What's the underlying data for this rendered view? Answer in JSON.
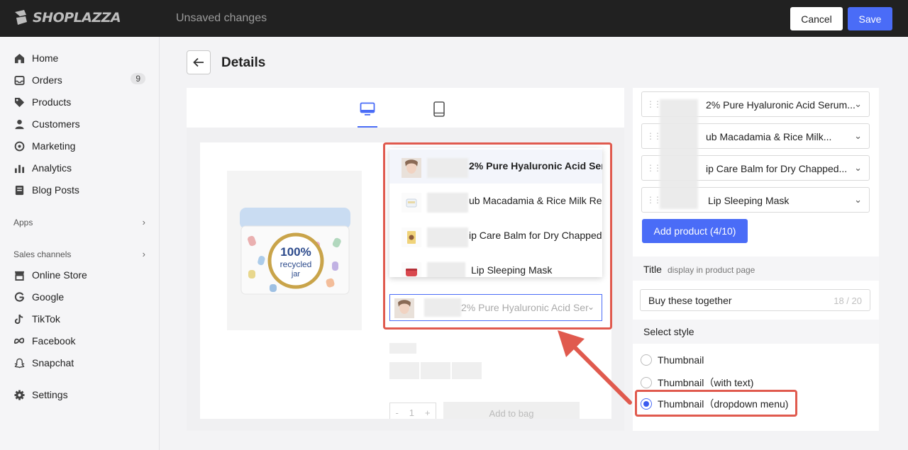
{
  "topbar": {
    "brand": "SHOPLAZZA",
    "status": "Unsaved changes",
    "cancel_label": "Cancel",
    "save_label": "Save"
  },
  "sidebar": {
    "items": [
      {
        "label": "Home",
        "icon": "home-icon"
      },
      {
        "label": "Orders",
        "icon": "inbox-icon",
        "badge": "9"
      },
      {
        "label": "Products",
        "icon": "tag-icon"
      },
      {
        "label": "Customers",
        "icon": "person-icon"
      },
      {
        "label": "Marketing",
        "icon": "target-icon"
      },
      {
        "label": "Analytics",
        "icon": "bar-chart-icon"
      },
      {
        "label": "Blog Posts",
        "icon": "document-icon"
      }
    ],
    "apps_label": "Apps",
    "channels_label": "Sales channels",
    "channels": [
      {
        "label": "Online Store",
        "icon": "store-icon"
      },
      {
        "label": "Google",
        "icon": "google-icon"
      },
      {
        "label": "TikTok",
        "icon": "tiktok-icon"
      },
      {
        "label": "Facebook",
        "icon": "meta-icon"
      },
      {
        "label": "Snapchat",
        "icon": "ghost-icon"
      }
    ],
    "settings_label": "Settings"
  },
  "header": {
    "title": "Details"
  },
  "preview": {
    "product_image_text": [
      "100%",
      "recycled",
      "jar"
    ],
    "dropdown": [
      {
        "text": "2% Pure Hyaluronic Acid Ser",
        "selected": true
      },
      {
        "text": "ub Macadamia & Rice Milk Re",
        "selected": false
      },
      {
        "text": "ip Care Balm for Dry Chapped",
        "selected": false
      },
      {
        "text": "Lip Sleeping Mask",
        "selected": false
      }
    ],
    "select_value": "2% Pure Hyaluronic Acid Ser",
    "quantity": "1",
    "qty_minus": "-",
    "qty_plus": "+",
    "add_to_bag": "Add to bag"
  },
  "panel": {
    "products": [
      {
        "text": "2% Pure Hyaluronic Acid Serum..."
      },
      {
        "text": "ub Macadamia & Rice Milk..."
      },
      {
        "text": "ip Care Balm for Dry Chapped..."
      },
      {
        "text": "Lip Sleeping Mask"
      }
    ],
    "add_product_label": "Add product (4/10)",
    "title_label": "Title",
    "title_hint": "display in product page",
    "title_value": "Buy these together",
    "title_count": "18 / 20",
    "style_label": "Select style",
    "styles": [
      {
        "label": "Thumbnail",
        "checked": false
      },
      {
        "label": "Thumbnail（with text)",
        "checked": false
      },
      {
        "label": "Thumbnail（dropdown menu)",
        "checked": true
      }
    ]
  },
  "colors": {
    "accent": "#4a6cf7",
    "topbar": "#212121",
    "highlight": "#e05a4e"
  }
}
